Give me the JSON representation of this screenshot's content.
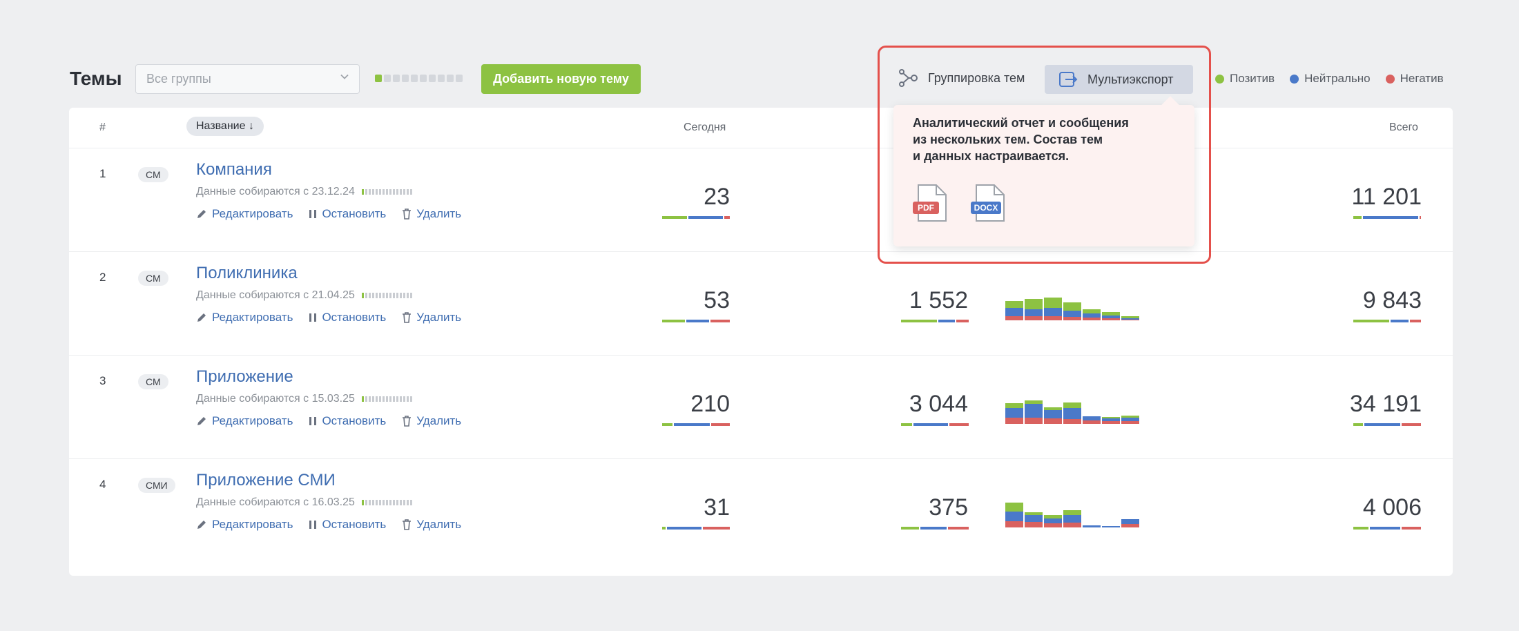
{
  "header": {
    "title": "Темы",
    "groups_select": "Все группы",
    "add_button": "Добавить новую тему",
    "grouping_button": "Группировка тем",
    "multiexport_button": "Мультиэкспорт",
    "legend": [
      {
        "label": "Позитив",
        "color": "#8dc242"
      },
      {
        "label": "Нейтрально",
        "color": "#4a79c9"
      },
      {
        "label": "Негатив",
        "color": "#d9615f"
      }
    ]
  },
  "table": {
    "col_num": "#",
    "col_name": "Название ↓",
    "col_today": "Сегодня",
    "col_total": "Всего",
    "rows": [
      {
        "num": "1",
        "badge": "СМ",
        "name": "Компания",
        "since": "Данные собираются с 23.12.24",
        "today": "23",
        "week": "",
        "total": "11 201"
      },
      {
        "num": "2",
        "badge": "СМ",
        "name": "Поликлиника",
        "since": "Данные собираются с 21.04.25",
        "today": "53",
        "week": "1 552",
        "total": "9 843"
      },
      {
        "num": "3",
        "badge": "СМ",
        "name": "Приложение",
        "since": "Данные собираются с 15.03.25",
        "today": "210",
        "week": "3 044",
        "total": "34 191"
      },
      {
        "num": "4",
        "badge": "СМИ",
        "name": "Приложение СМИ",
        "since": "Данные собираются с 16.03.25",
        "today": "31",
        "week": "375",
        "total": "4 006"
      }
    ],
    "action_edit": "Редактировать",
    "action_stop": "Остановить",
    "action_delete": "Удалить"
  },
  "popup": {
    "text_line1": "Аналитический отчет и сообщения",
    "text_line2": "из нескольких тем. Состав тем",
    "text_line3": "и данных настраивается.",
    "pdf_label": "PDF",
    "docx_label": "DOCX"
  }
}
